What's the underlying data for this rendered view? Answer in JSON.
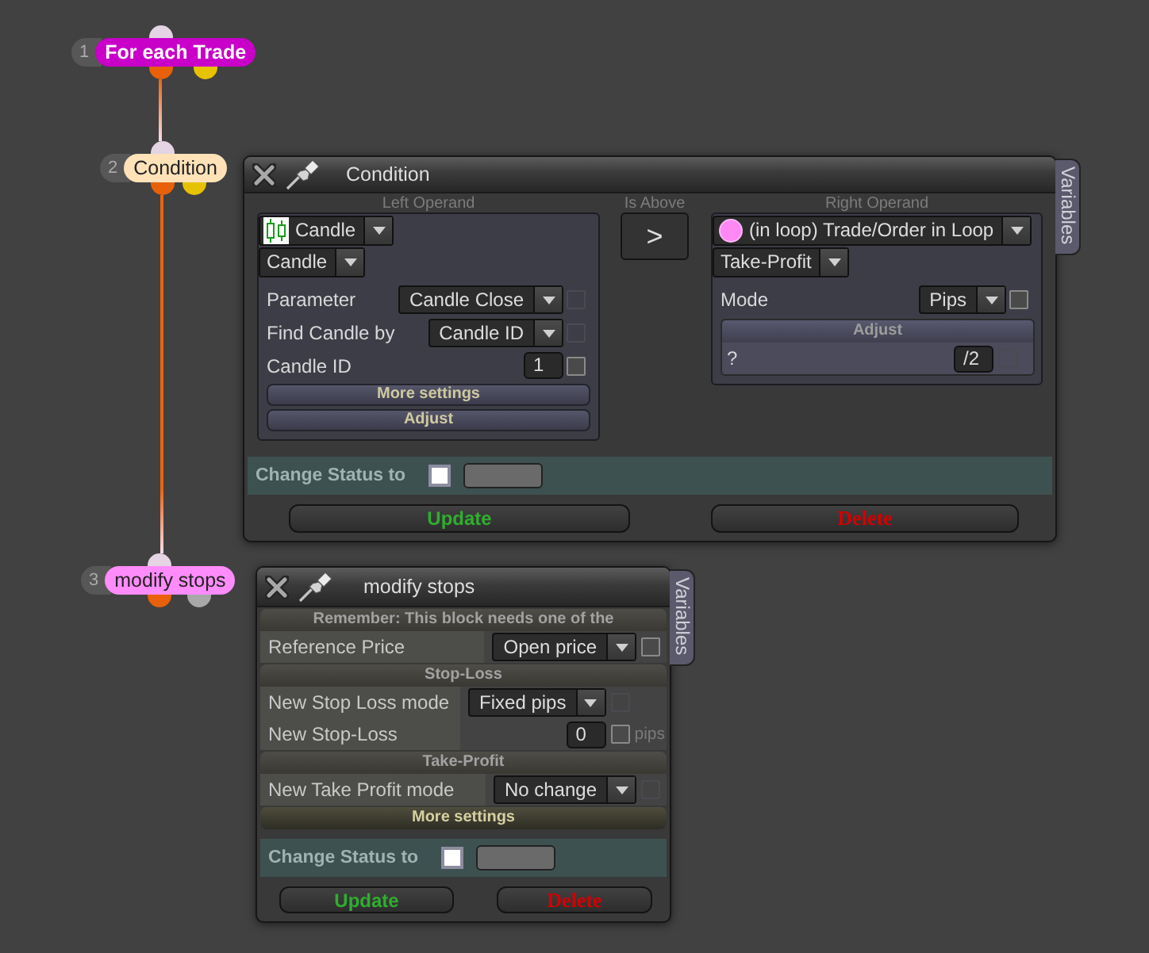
{
  "nodes": [
    {
      "number": "1",
      "label": "For each Trade",
      "color": "#c800c8",
      "outputs": [
        {
          "color": "#e8610a"
        },
        {
          "color": "#e6c200"
        }
      ]
    },
    {
      "number": "2",
      "label": "Condition",
      "color": "#ffe2b8",
      "outputs": [
        {
          "color": "#e8610a"
        },
        {
          "color": "#e6c200"
        }
      ]
    },
    {
      "number": "3",
      "label": "modify stops",
      "color": "#ff8cfa",
      "outputs": [
        {
          "color": "#e8610a"
        },
        {
          "color": "#a8a8a8"
        }
      ]
    }
  ],
  "condition_dialog": {
    "title": "Condition",
    "side_tab": "Variables",
    "left_operand": {
      "heading": "Left Operand",
      "source": {
        "kind": "candle",
        "value": "Candle"
      },
      "type": "Candle",
      "params": [
        {
          "label": "Parameter",
          "kind": "select",
          "value": "Candle Close",
          "checked": false,
          "disabled": true
        },
        {
          "label": "Find Candle by",
          "kind": "select",
          "value": "Candle ID",
          "checked": false,
          "disabled": true
        },
        {
          "label": "Candle ID",
          "kind": "number",
          "value": "1",
          "checked": false,
          "disabled": false
        }
      ],
      "bars": [
        "More settings",
        "Adjust"
      ]
    },
    "comparator": {
      "heading": "Is Above",
      "symbol": ">"
    },
    "right_operand": {
      "heading": "Right Operand",
      "source": {
        "kind": "trade",
        "value": "(in loop) Trade/Order in Loop"
      },
      "type": "Take-Profit",
      "params": [
        {
          "label": "Mode",
          "kind": "select",
          "value": "Pips",
          "checked": false,
          "disabled": false
        }
      ],
      "adjust": {
        "heading": "Adjust",
        "label": "?",
        "value": "/2",
        "checked": false,
        "disabled": true
      }
    },
    "status": {
      "label": "Change Status to",
      "checked": false
    },
    "buttons": [
      {
        "label": "Update",
        "kind": "update"
      },
      {
        "label": "Delete",
        "kind": "delete"
      }
    ]
  },
  "modify_dialog": {
    "title": "modify stops",
    "side_tab": "Variables",
    "sections": [
      {
        "heading": "Remember: This block needs one of the",
        "rows": [
          {
            "label": "Reference Price",
            "kind": "select",
            "value": "Open price",
            "checked": false,
            "disabled": false
          }
        ]
      },
      {
        "heading": "Stop-Loss",
        "rows": [
          {
            "label": "New Stop Loss mode",
            "kind": "select",
            "value": "Fixed pips",
            "checked": false,
            "disabled": true
          },
          {
            "label": "New Stop-Loss",
            "kind": "number",
            "value": "0",
            "checked": false,
            "disabled": false,
            "unit": "pips"
          }
        ]
      },
      {
        "heading": "Take-Profit",
        "rows": [
          {
            "label": "New Take Profit mode",
            "kind": "select",
            "value": "No change",
            "checked": false,
            "disabled": true
          }
        ]
      }
    ],
    "bars": [
      "More settings"
    ],
    "status": {
      "label": "Change Status to",
      "checked": false
    },
    "buttons": [
      {
        "label": "Update",
        "kind": "update"
      },
      {
        "label": "Delete",
        "kind": "delete"
      }
    ]
  }
}
